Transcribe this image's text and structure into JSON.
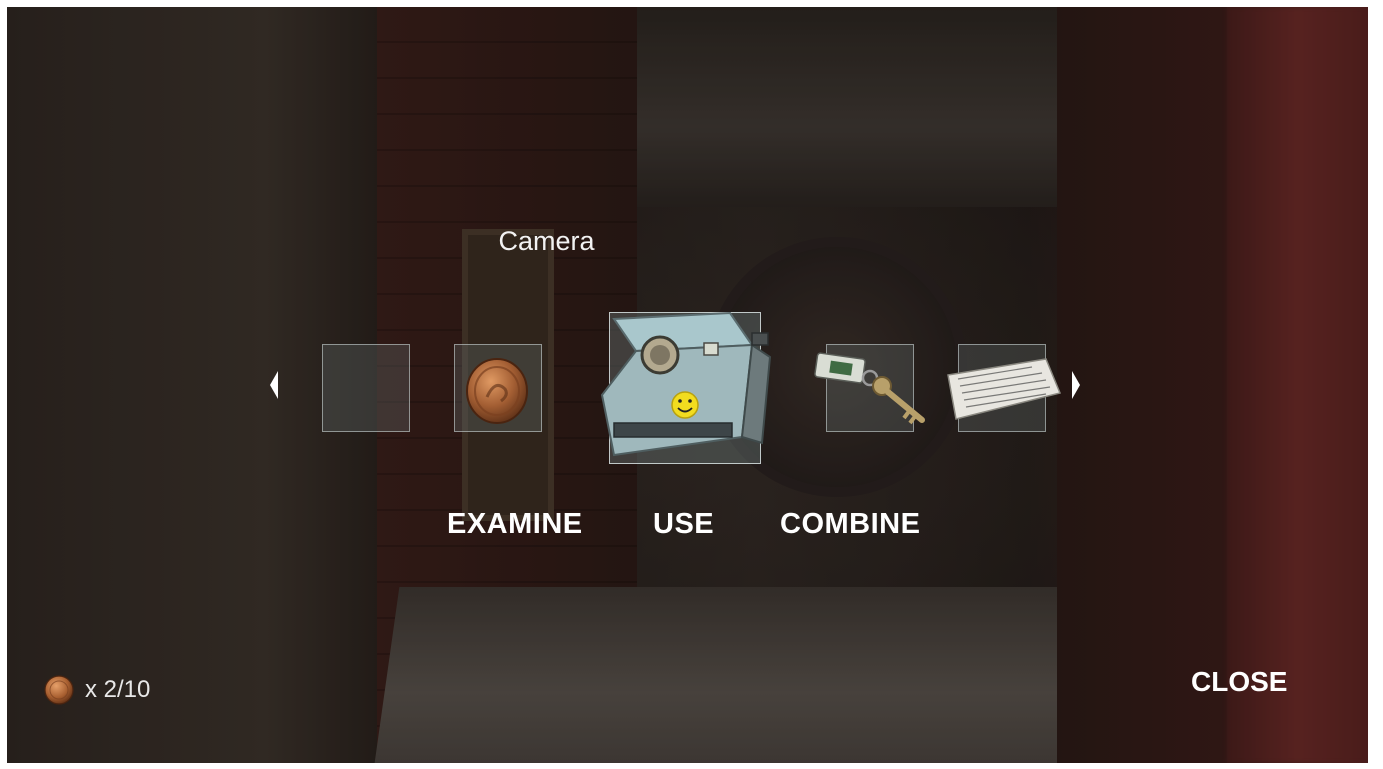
{
  "item": {
    "name": "Camera"
  },
  "carousel": {
    "slots": [
      {
        "id": "empty",
        "icon": "empty-slot"
      },
      {
        "id": "coin",
        "icon": "coin-icon"
      },
      {
        "id": "camera",
        "icon": "instant-camera-icon",
        "selected": true
      },
      {
        "id": "key",
        "icon": "key-with-tag-icon"
      },
      {
        "id": "note",
        "icon": "paper-note-icon"
      }
    ],
    "left_arrow_icon": "chevron-left-icon",
    "right_arrow_icon": "chevron-right-icon"
  },
  "actions": {
    "examine": "EXAMINE",
    "use": "USE",
    "combine": "COMBINE"
  },
  "close_label": "CLOSE",
  "coins": {
    "icon": "coin-icon",
    "count_text": "x 2/10",
    "collected": 2,
    "total": 10
  },
  "colors": {
    "text": "#ffffff",
    "slot_border": "#d7e1e1",
    "coin": "#b06a3a"
  }
}
